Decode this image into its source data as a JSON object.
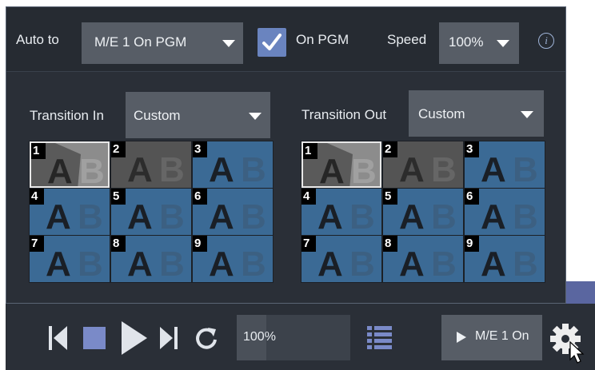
{
  "topbar": {
    "auto_to_label": "Auto to",
    "auto_to_value": "M/E 1 On PGM",
    "on_pgm_label": "On PGM",
    "on_pgm_checked": true,
    "speed_label": "Speed",
    "speed_value": "100%",
    "info_glyph": "i"
  },
  "transition_in": {
    "label": "Transition In",
    "value": "Custom",
    "cells": [
      {
        "num": "1",
        "style": "ab-wipe",
        "selected": true
      },
      {
        "num": "2",
        "style": "ab-gray",
        "selected": false
      },
      {
        "num": "3",
        "style": "ab-blue",
        "selected": false
      },
      {
        "num": "4",
        "style": "ab-blue",
        "selected": false
      },
      {
        "num": "5",
        "style": "ab-blue",
        "selected": false
      },
      {
        "num": "6",
        "style": "ab-blue",
        "selected": false
      },
      {
        "num": "7",
        "style": "ab-blue",
        "selected": false
      },
      {
        "num": "8",
        "style": "ab-blue",
        "selected": false
      },
      {
        "num": "9",
        "style": "ab-blue",
        "selected": false
      }
    ]
  },
  "transition_out": {
    "label": "Transition Out",
    "value": "Custom",
    "cells": [
      {
        "num": "1",
        "style": "ab-wipe",
        "selected": true
      },
      {
        "num": "2",
        "style": "ab-gray",
        "selected": false
      },
      {
        "num": "3",
        "style": "ab-blue",
        "selected": false
      },
      {
        "num": "4",
        "style": "ab-blue",
        "selected": false
      },
      {
        "num": "5",
        "style": "ab-blue",
        "selected": false
      },
      {
        "num": "6",
        "style": "ab-blue",
        "selected": false
      },
      {
        "num": "7",
        "style": "ab-blue",
        "selected": false
      },
      {
        "num": "8",
        "style": "ab-blue",
        "selected": false
      },
      {
        "num": "9",
        "style": "ab-blue",
        "selected": false
      }
    ]
  },
  "transport": {
    "icons": [
      "skip-to-start-icon",
      "stop-icon",
      "play-icon",
      "skip-to-end-icon",
      "loop-icon",
      "playlist-icon"
    ],
    "progress_text": "100%",
    "progress_fraction": 0.26,
    "run_button_label": "M/E 1 On",
    "gear_icon": "gear-icon"
  },
  "colors": {
    "accent": "#6a84bf",
    "panel": "#2a2f37",
    "cell_blue": "#3b6a95",
    "cell_gray": "#545454"
  }
}
